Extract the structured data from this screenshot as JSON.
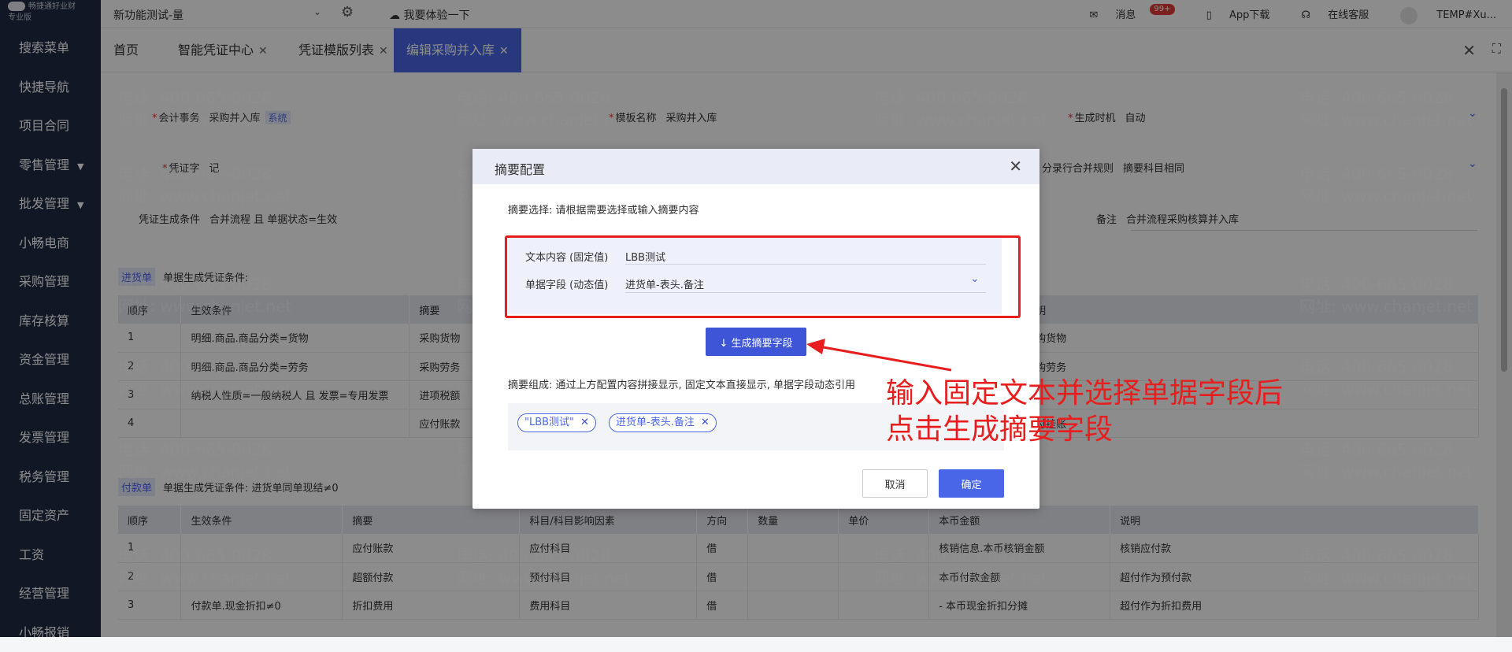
{
  "sidebar": {
    "brand": "畅捷通好业财",
    "tier": "专业版",
    "items": [
      {
        "label": "搜索菜单",
        "caret": ""
      },
      {
        "label": "快捷导航",
        "caret": ""
      },
      {
        "label": "项目合同",
        "caret": ""
      },
      {
        "label": "零售管理",
        "caret": "▼"
      },
      {
        "label": "批发管理",
        "caret": "▼"
      },
      {
        "label": "小畅电商",
        "caret": ""
      },
      {
        "label": "采购管理",
        "caret": ""
      },
      {
        "label": "库存核算",
        "caret": ""
      },
      {
        "label": "资金管理",
        "caret": ""
      },
      {
        "label": "总账管理",
        "caret": ""
      },
      {
        "label": "发票管理",
        "caret": ""
      },
      {
        "label": "税务管理",
        "caret": ""
      },
      {
        "label": "固定资产",
        "caret": ""
      },
      {
        "label": "工资",
        "caret": ""
      },
      {
        "label": "经营管理",
        "caret": ""
      },
      {
        "label": "小畅报销",
        "caret": ""
      }
    ]
  },
  "topbar": {
    "company": "新功能测试-量",
    "experience": "我要体验一下",
    "messages": "消息",
    "badge": "99+",
    "app_download": "App下载",
    "online_service": "在线客服",
    "user": "TEMP#Xu..."
  },
  "tabs": [
    {
      "label": "首页",
      "closable": false
    },
    {
      "label": "智能凭证中心",
      "closable": true
    },
    {
      "label": "凭证模版列表",
      "closable": true
    },
    {
      "label": "编辑采购并入库",
      "closable": true
    }
  ],
  "form": {
    "accounting_affair_label": "会计事务",
    "accounting_affair_value": "采购并入库",
    "system_tag": "系统",
    "template_name_label": "模板名称",
    "template_name_value": "采购并入库",
    "gen_time_label": "生成时机",
    "gen_time_value": "自动",
    "voucher_word_label": "凭证字",
    "voucher_word_value": "记",
    "merge_rule_label": "分录行合并规则",
    "merge_rule_value": "摘要科目相同",
    "gen_condition_label": "凭证生成条件",
    "gen_condition_value": "合并流程 且 单据状态=生效",
    "remark_label": "备注",
    "remark_value": "合并流程采购核算并入库"
  },
  "section1": {
    "tag": "进货单",
    "title": "单据生成凭证条件:",
    "headers": [
      "顺序",
      "生效条件",
      "摘要",
      "额",
      "说明"
    ],
    "rows": [
      [
        "1",
        "明细.商品.商品分类=货物",
        "采购货物",
        "",
        "采购货物"
      ],
      [
        "2",
        "明细.商品.商品分类=劳务",
        "采购劳务",
        "",
        "采购劳务"
      ],
      [
        "3",
        "纳税人性质=一般纳税人 且 发票=专用发票",
        "进项税额",
        "",
        ""
      ],
      [
        "4",
        "",
        "应付账款",
        "",
        "应付挂账"
      ]
    ]
  },
  "section2": {
    "tag": "付款单",
    "title": "单据生成凭证条件: 进货单同单现结≠0",
    "headers": [
      "顺序",
      "生效条件",
      "摘要",
      "科目/科目影响因素",
      "方向",
      "数量",
      "单价",
      "本币金额",
      "说明"
    ],
    "rows": [
      [
        "1",
        "",
        "应付账款",
        "应付科目",
        "借",
        "",
        "",
        "核销信息.本币核销金额",
        "核销应付款"
      ],
      [
        "2",
        "",
        "超额付款",
        "预付科目",
        "借",
        "",
        "",
        "本币付款金额",
        "超付作为预付款"
      ],
      [
        "3",
        "付款单.现金折扣≠0",
        "折扣费用",
        "费用科目",
        "借",
        "",
        "",
        "- 本币现金折扣分摊",
        "超付作为折扣费用"
      ]
    ]
  },
  "watermark": {
    "phone": "电话: 400-665-0028",
    "site": "网址: www.chanjet.net"
  },
  "modal": {
    "title": "摘要配置",
    "hint": "摘要选择: 请根据需要选择或输入摘要内容",
    "text_label": "文本内容 (固定值)",
    "text_value": "LBB测试",
    "field_label": "单据字段 (动态值)",
    "field_value": "进货单-表头.备注",
    "generate_btn": "↓ 生成摘要字段",
    "compose_hint": "摘要组成: 通过上方配置内容拼接显示, 固定文本直接显示, 单据字段动态引用",
    "chips": [
      "\"LBB测试\"",
      "进货单-表头.备注"
    ],
    "cancel": "取消",
    "ok": "确定"
  },
  "annotation": {
    "line1": "输入固定文本并选择单据字段后",
    "line2": "点击生成摘要字段",
    "color": "#e81e1e"
  },
  "colors": {
    "sidebar_bg": "#1f2a44",
    "accent": "#4a66e8"
  }
}
